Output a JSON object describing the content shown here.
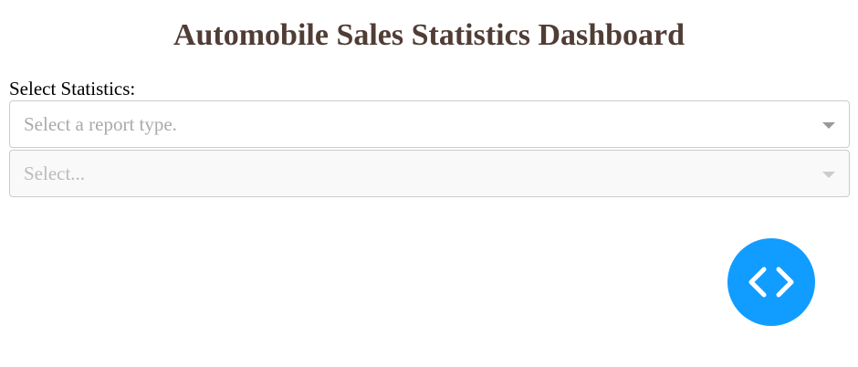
{
  "header": {
    "title": "Automobile Sales Statistics Dashboard"
  },
  "form": {
    "statistics_label": "Select Statistics:",
    "report_type_dropdown": {
      "placeholder": "Select a report type.",
      "selected_value": ""
    },
    "year_dropdown": {
      "placeholder": "Select...",
      "selected_value": "",
      "disabled": true
    }
  },
  "devtools": {
    "icon": "code-brackets-icon"
  },
  "colors": {
    "title": "#503d36",
    "placeholder": "#aaaaaa",
    "disabled_placeholder": "#bbbbbb",
    "accent": "#119dff"
  }
}
